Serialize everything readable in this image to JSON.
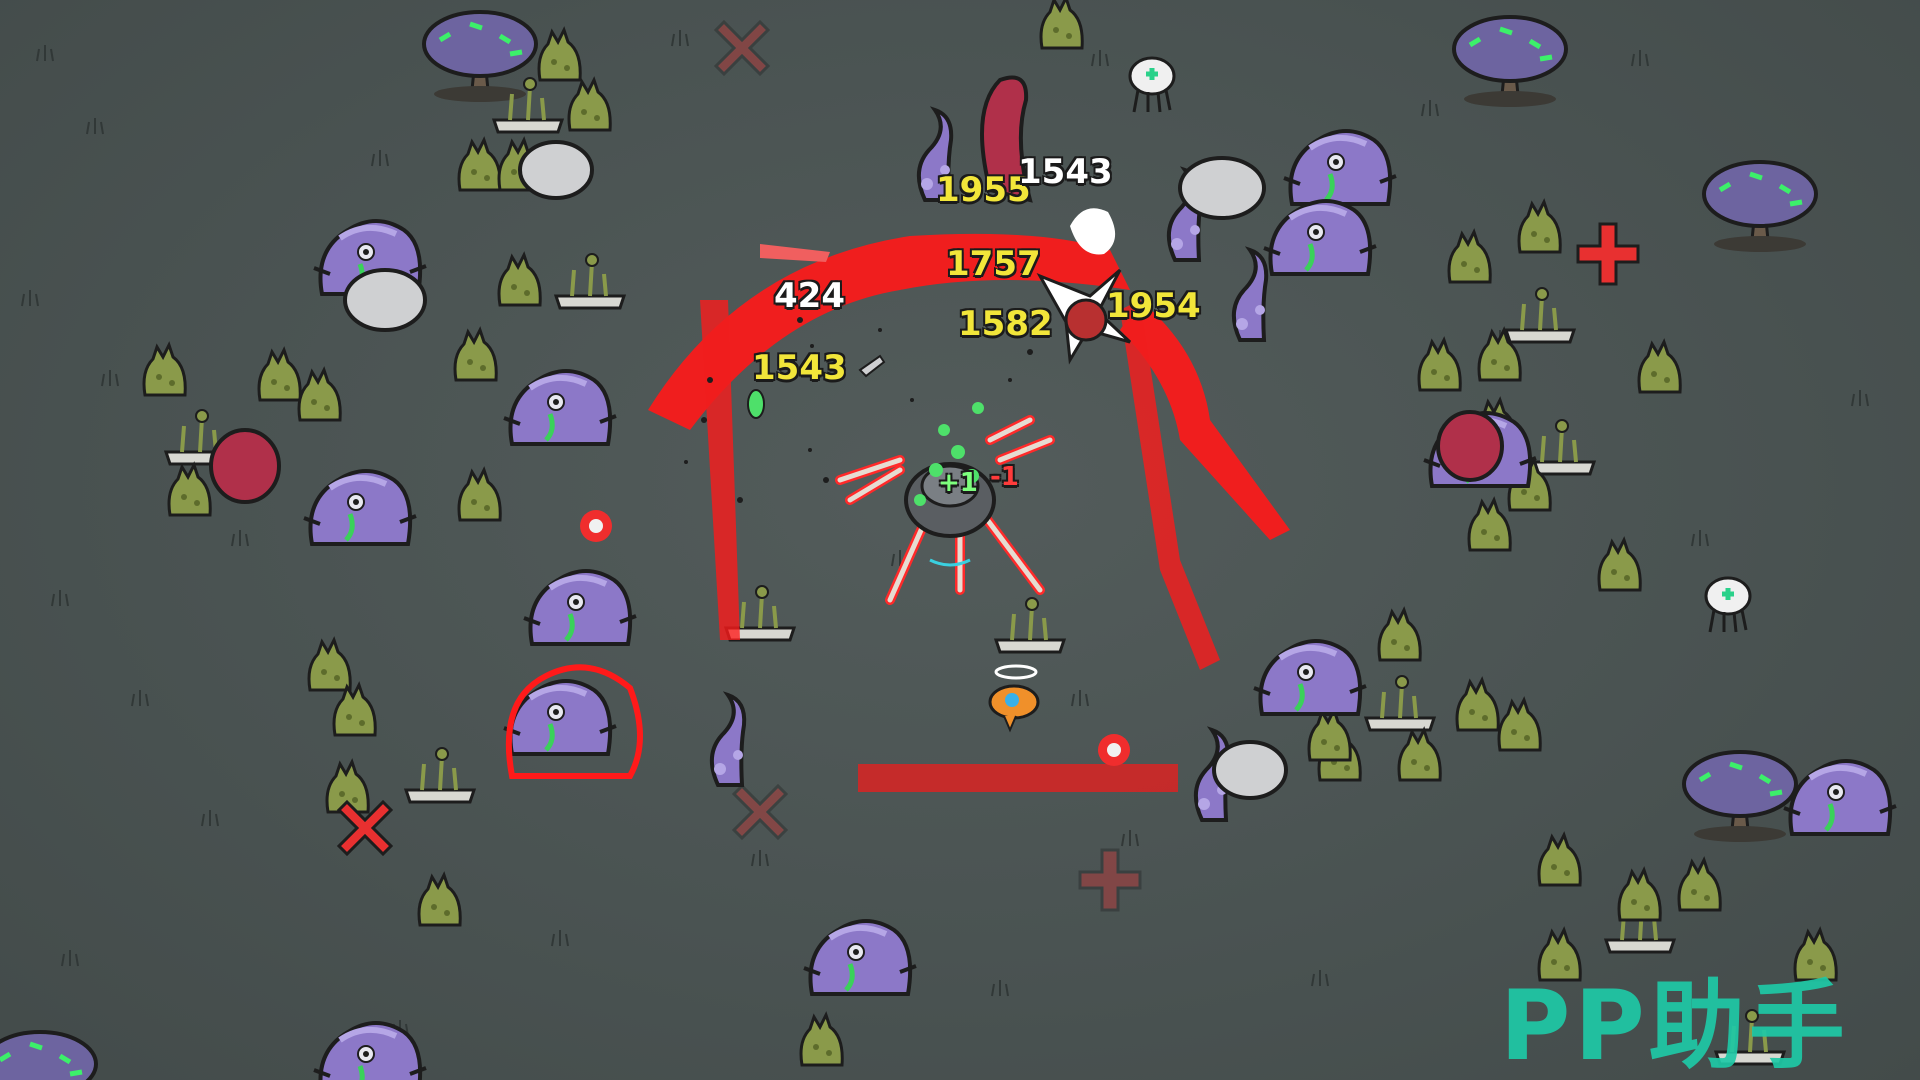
{
  "damage_numbers": [
    {
      "text": "1955",
      "style": "yellow"
    },
    {
      "text": "1543",
      "style": "white"
    },
    {
      "text": "1757",
      "style": "yellow"
    },
    {
      "text": "424",
      "style": "white"
    },
    {
      "text": "1582",
      "style": "yellow"
    },
    {
      "text": "1954",
      "style": "yellow"
    },
    {
      "text": "1543",
      "style": "yellow"
    },
    {
      "text": "+1",
      "style": "green"
    },
    {
      "text": "-1",
      "style": "red"
    }
  ],
  "watermark": "PP助手",
  "colors": {
    "ground": "#4a5352",
    "enemy_purple": "#8c78c8",
    "enemy_green": "#8a9a4a",
    "attack_red": "#ff1a1a",
    "damage_yellow": "#f2e63a",
    "watermark": "#1fc9a6"
  },
  "entities": {
    "player": "mech-spider-player",
    "drone": "orange-companion-drone",
    "medkits": [
      "medkit-top",
      "medkit-right"
    ]
  }
}
